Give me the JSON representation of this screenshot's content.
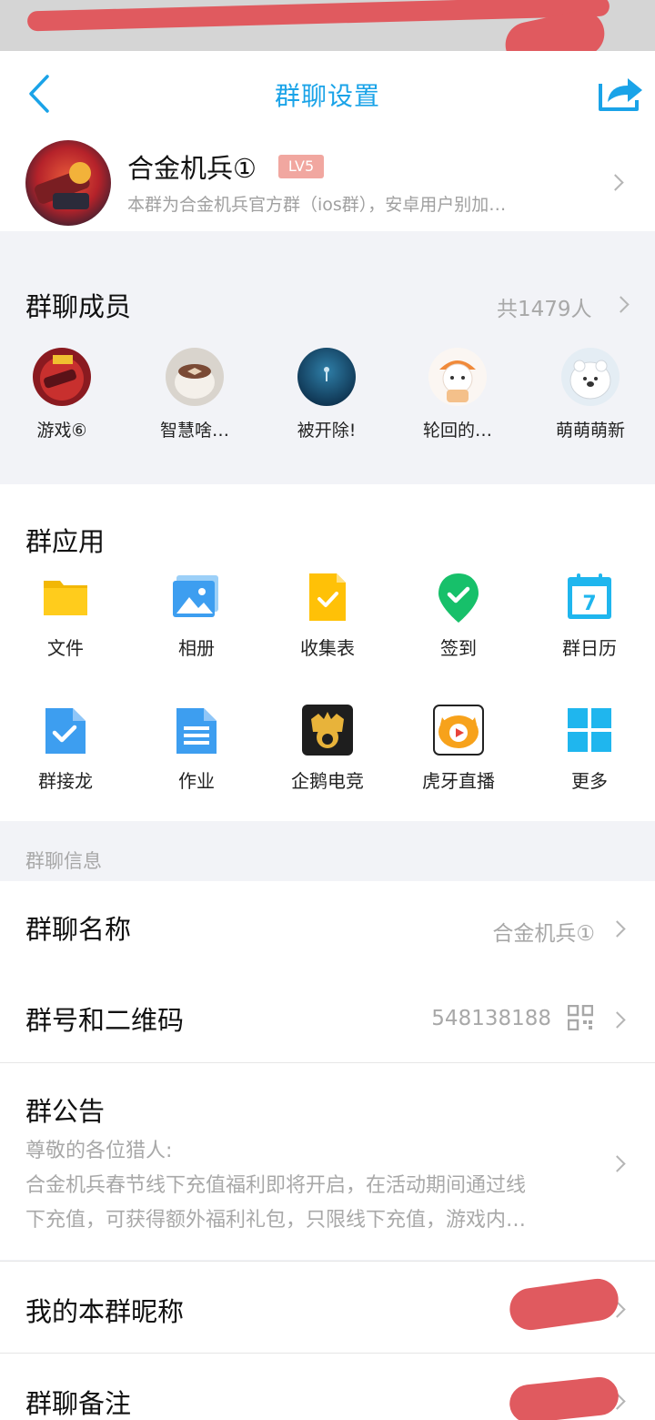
{
  "nav": {
    "title": "群聊设置"
  },
  "group": {
    "name": "合金机兵①",
    "level": "LV5",
    "description": "本群为合金机兵官方群（ios群），安卓用户别加…"
  },
  "members": {
    "title": "群聊成员",
    "count": "共1479人",
    "items": [
      {
        "name": "游戏⑥"
      },
      {
        "name": "智慧啥…"
      },
      {
        "name": "被开除!"
      },
      {
        "name": "轮回的…"
      },
      {
        "name": "萌萌萌新"
      }
    ]
  },
  "apps": {
    "title": "群应用",
    "items": [
      {
        "label": "文件",
        "icon": "folder-icon"
      },
      {
        "label": "相册",
        "icon": "photo-album-icon"
      },
      {
        "label": "收集表",
        "icon": "collect-form-icon"
      },
      {
        "label": "签到",
        "icon": "check-in-icon"
      },
      {
        "label": "群日历",
        "icon": "calendar-icon"
      },
      {
        "label": "群接龙",
        "icon": "relay-icon"
      },
      {
        "label": "作业",
        "icon": "homework-icon"
      },
      {
        "label": "企鹅电竞",
        "icon": "penguin-esports-icon"
      },
      {
        "label": "虎牙直播",
        "icon": "huya-live-icon"
      },
      {
        "label": "更多",
        "icon": "more-apps-icon"
      }
    ]
  },
  "info": {
    "section_label": "群聊信息",
    "name_row": {
      "title": "群聊名称",
      "value": "合金机兵①"
    },
    "number_row": {
      "title": "群号和二维码",
      "value": "548138188"
    },
    "notice_row": {
      "title": "群公告",
      "line1": "尊敬的各位猎人:",
      "line2": "合金机兵春节线下充值福利即将开启，在活动期间通过线",
      "line3": "下充值，可获得额外福利礼包，只限线下充值，游戏内…"
    },
    "nickname_row": {
      "title": "我的本群昵称"
    },
    "remark_row": {
      "title": "群聊备注"
    }
  },
  "colors": {
    "accent": "#1aa3e8",
    "level_badge": "#f1a7a0",
    "redaction": "#e05a5f"
  }
}
